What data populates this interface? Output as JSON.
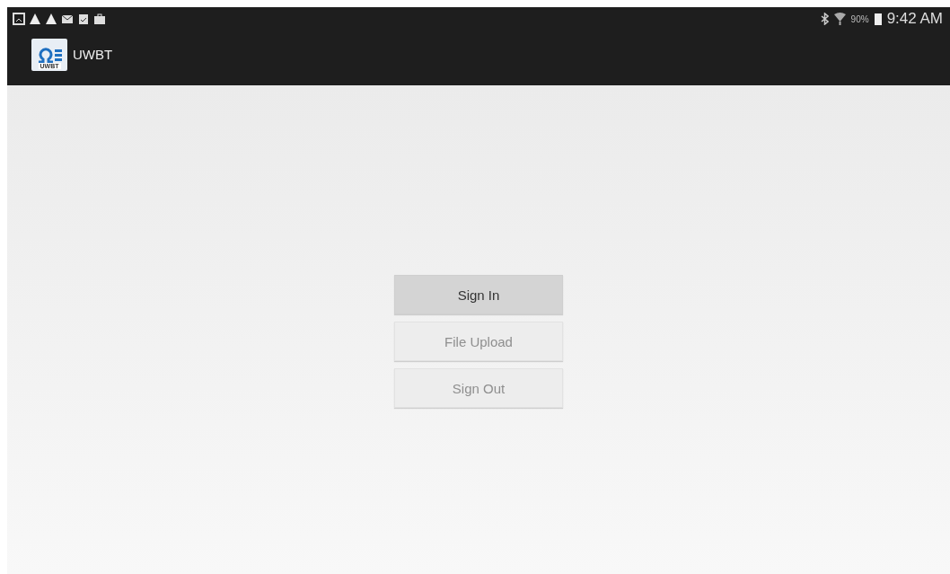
{
  "status_bar": {
    "battery": "90%",
    "time": "9:42 AM"
  },
  "app_bar": {
    "logo_text": "UWBT",
    "title": "UWBT"
  },
  "buttons": [
    {
      "label": "Sign In",
      "disabled": false
    },
    {
      "label": "File Upload",
      "disabled": true
    },
    {
      "label": "Sign Out",
      "disabled": true
    }
  ]
}
